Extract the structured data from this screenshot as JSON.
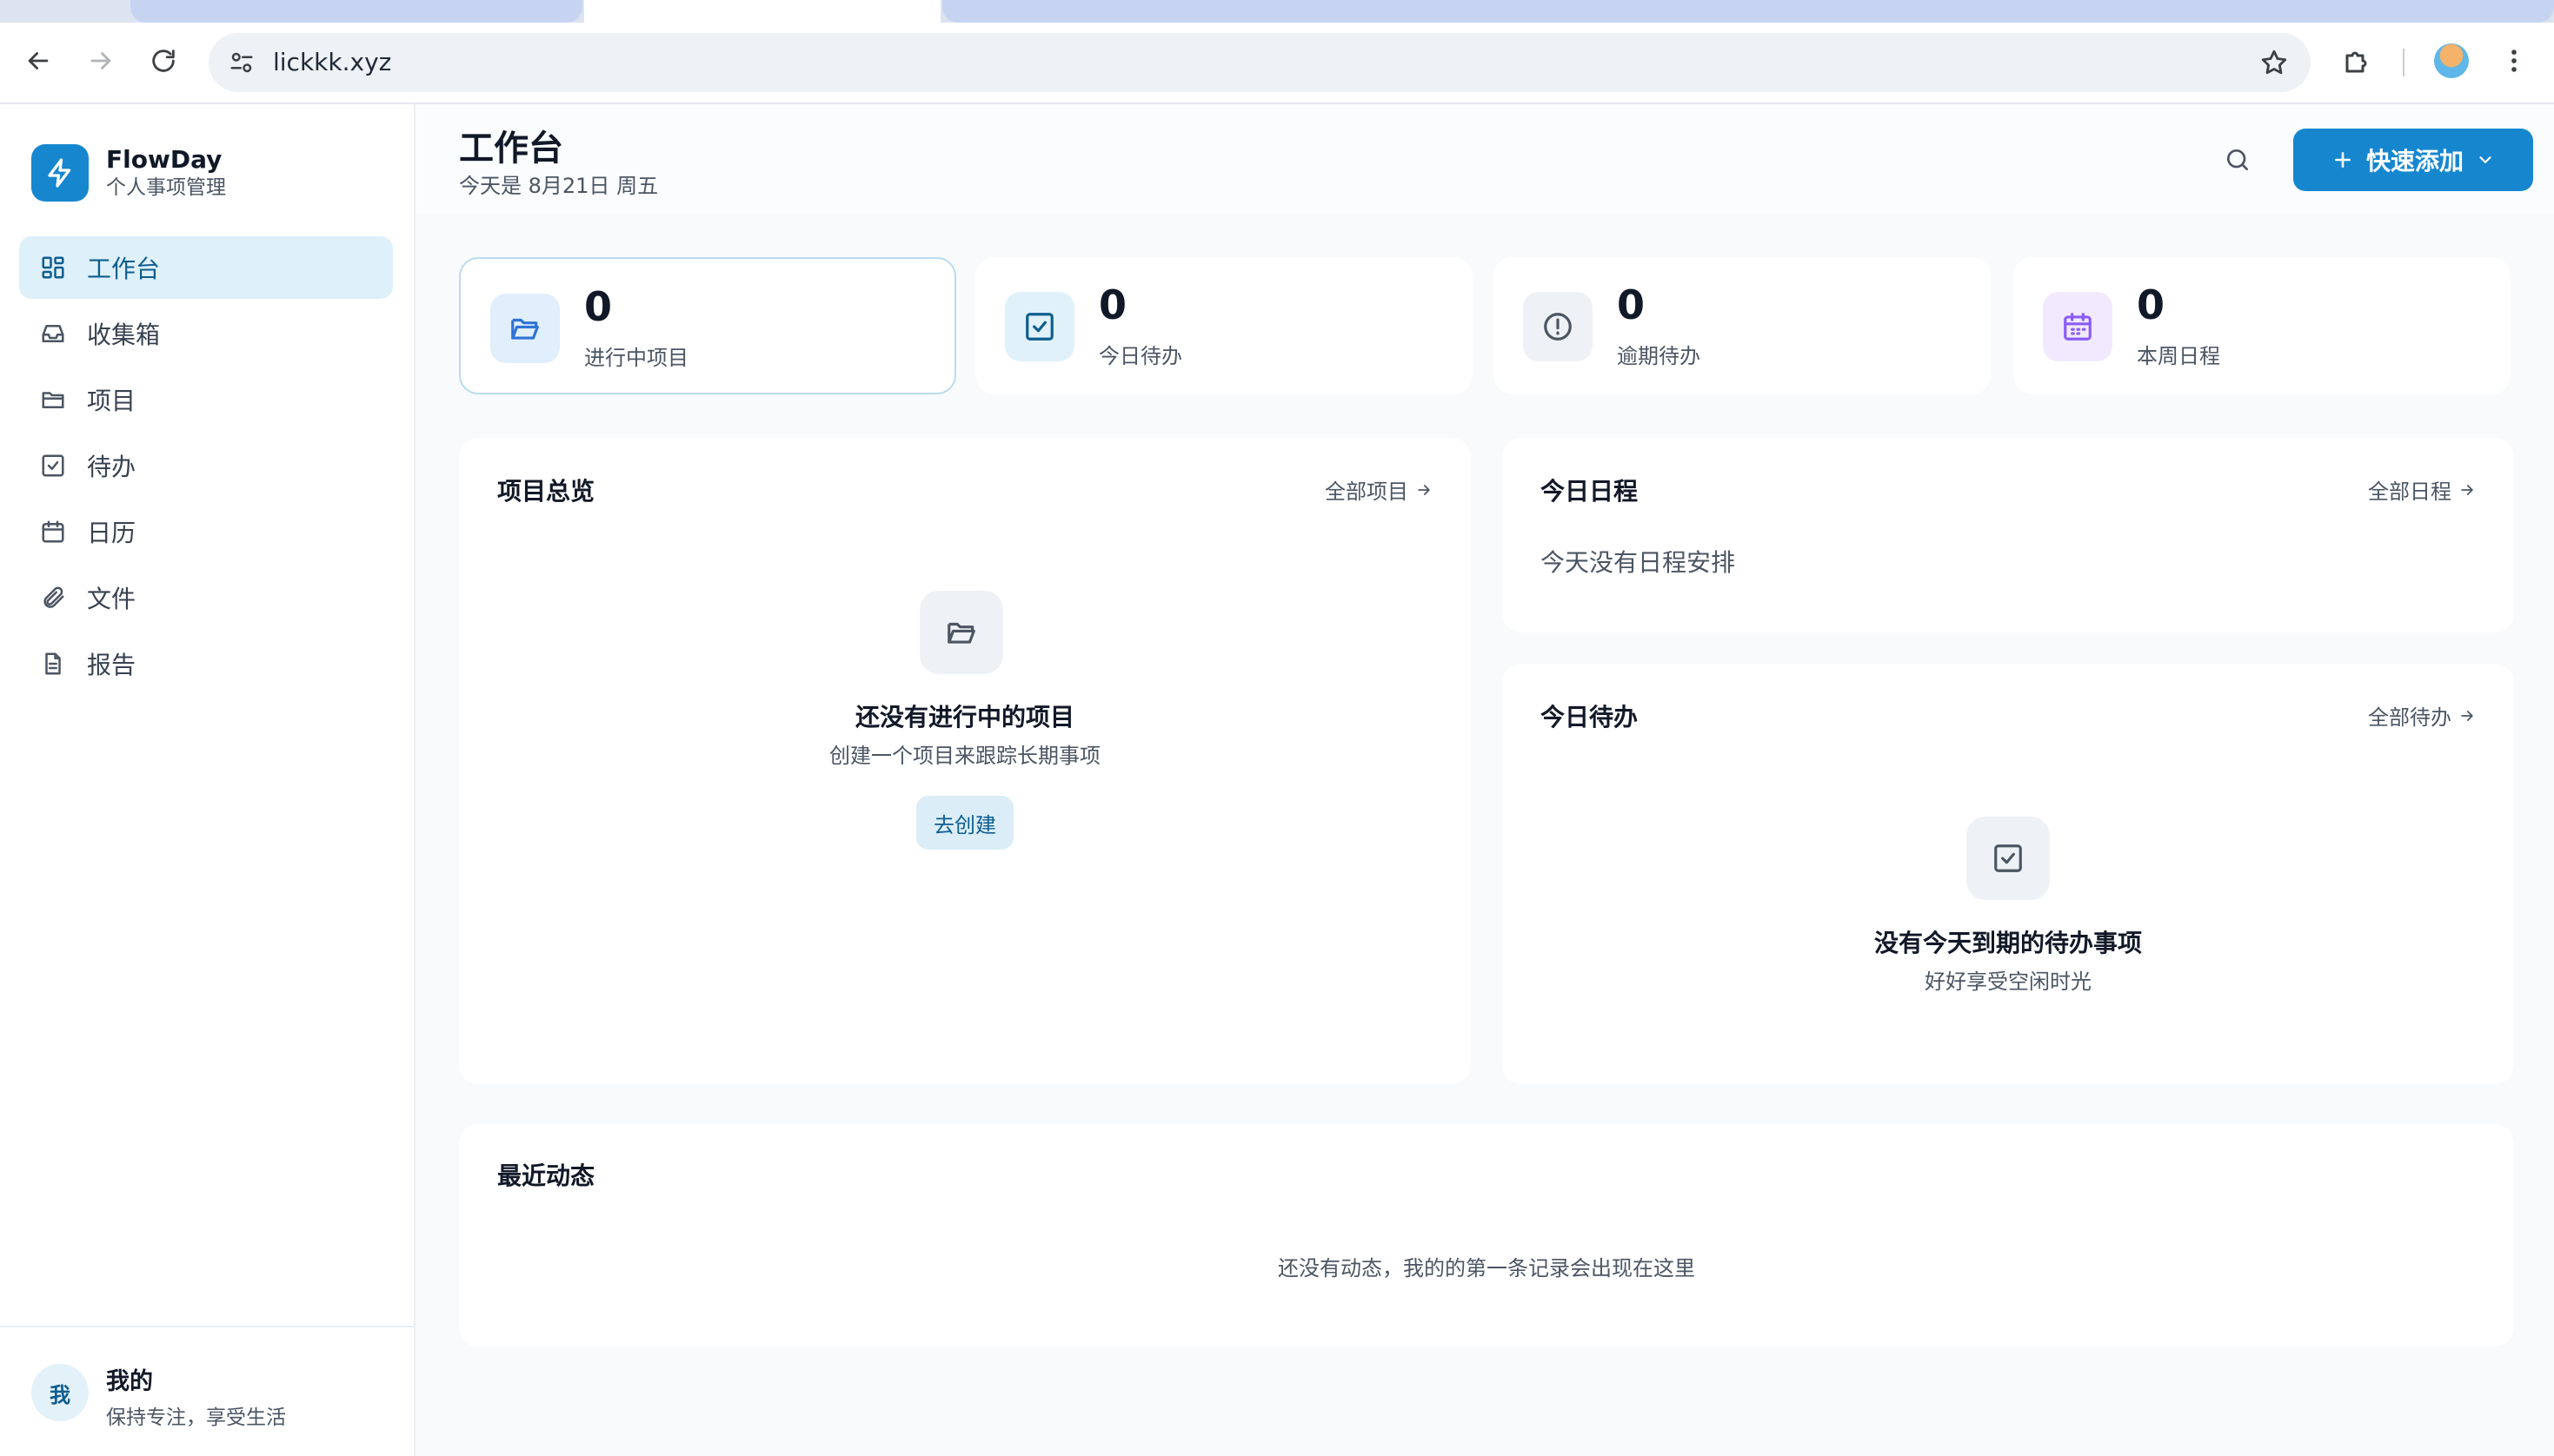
{
  "browser": {
    "url": "lickkk.xyz"
  },
  "app": {
    "brand_name": "FlowDay",
    "brand_subtitle": "个人事项管理"
  },
  "sidebar": {
    "items": [
      {
        "label": "工作台",
        "icon": "dashboard-icon"
      },
      {
        "label": "收集箱",
        "icon": "inbox-icon"
      },
      {
        "label": "项目",
        "icon": "folder-icon"
      },
      {
        "label": "待办",
        "icon": "checkbox-icon"
      },
      {
        "label": "日历",
        "icon": "calendar-icon"
      },
      {
        "label": "文件",
        "icon": "paperclip-icon"
      },
      {
        "label": "报告",
        "icon": "report-icon"
      }
    ],
    "active_index": 0
  },
  "profile": {
    "avatar_text": "我",
    "name": "我的",
    "subtitle": "保持专注，享受生活"
  },
  "header": {
    "title": "工作台",
    "date": "今天是 8月21日 周五",
    "quick_add_label": "快速添加"
  },
  "stats": [
    {
      "value": "0",
      "label": "进行中项目",
      "icon": "folder-open-icon"
    },
    {
      "value": "0",
      "label": "今日待办",
      "icon": "checkbox-icon"
    },
    {
      "value": "0",
      "label": "逾期待办",
      "icon": "alert-circle-icon"
    },
    {
      "value": "0",
      "label": "本周日程",
      "icon": "calendar-icon"
    }
  ],
  "projects_panel": {
    "title": "项目总览",
    "link": "全部项目",
    "empty_title": "还没有进行中的项目",
    "empty_sub": "创建一个项目来跟踪长期事项",
    "create_button": "去创建"
  },
  "schedule_panel": {
    "title": "今日日程",
    "link": "全部日程",
    "empty_text": "今天没有日程安排"
  },
  "todo_panel": {
    "title": "今日待办",
    "link": "全部待办",
    "empty_title": "没有今天到期的待办事项",
    "empty_sub": "好好享受空闲时光"
  },
  "activity_panel": {
    "title": "最近动态",
    "empty_text": "还没有动态，我的的第一条记录会出现在这里"
  },
  "colors": {
    "primary": "#1687cf",
    "active_nav_bg": "#def0fa",
    "overdue_icon_bg": "#eef2f6",
    "calendar_icon_bg": "#f1e9fd",
    "calendar_icon_color": "#8b5cf6"
  }
}
